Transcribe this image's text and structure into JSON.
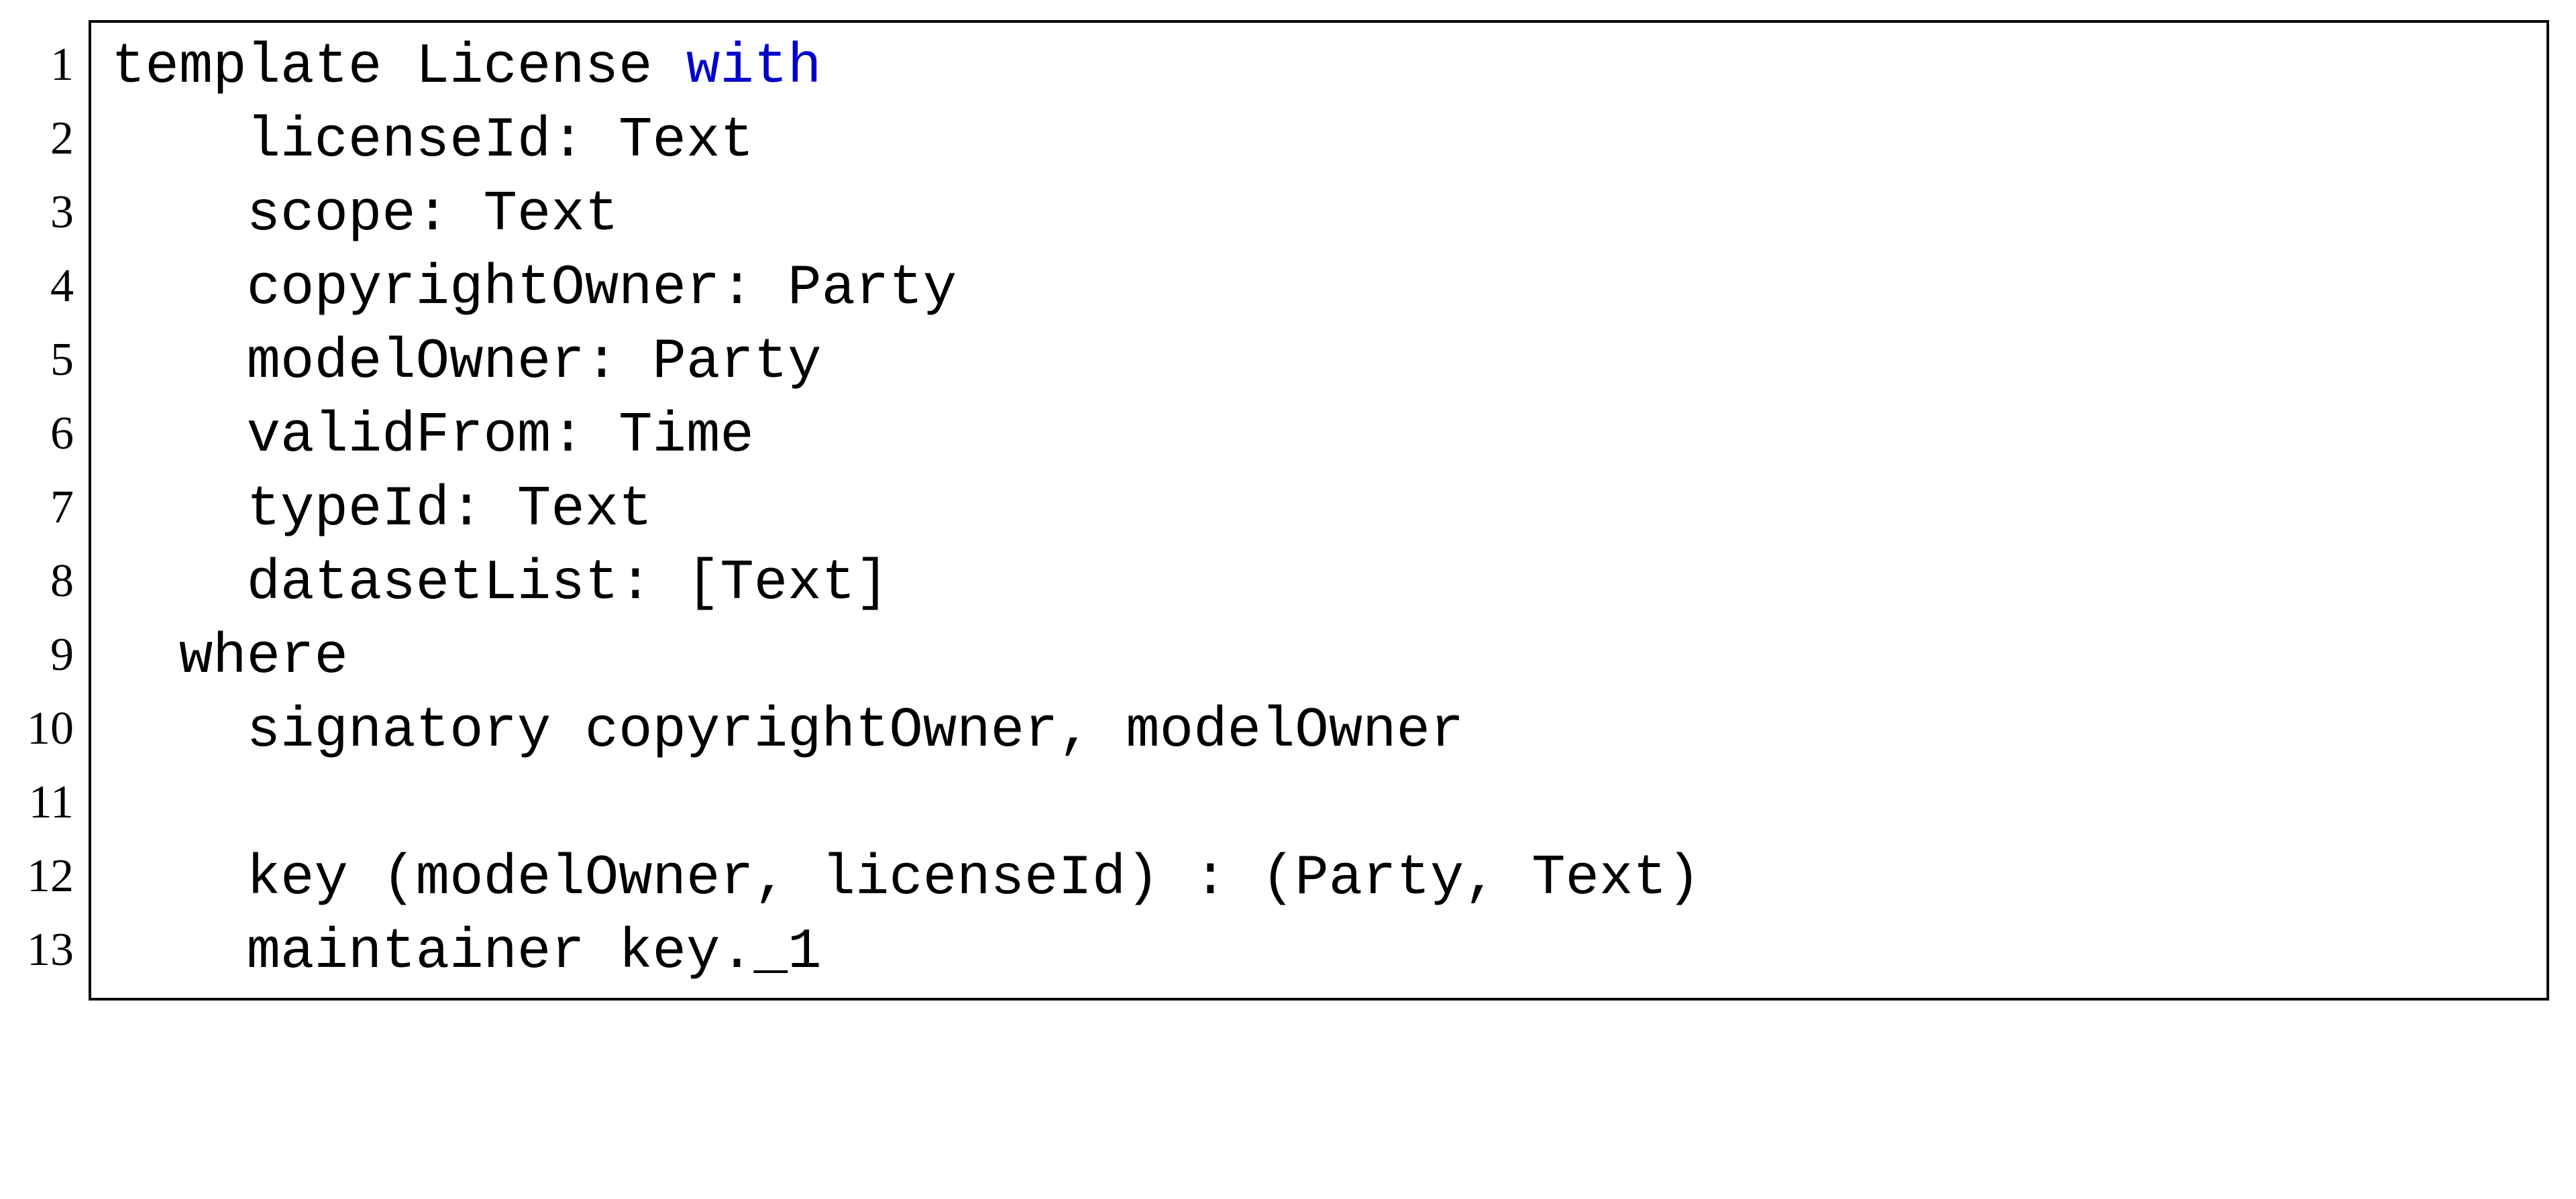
{
  "code": {
    "lines": [
      {
        "num": "1",
        "indent": "",
        "pre": "template License ",
        "kw": "with",
        "post": ""
      },
      {
        "num": "2",
        "indent": "    ",
        "pre": "licenseId: Text",
        "kw": "",
        "post": ""
      },
      {
        "num": "3",
        "indent": "    ",
        "pre": "scope: Text",
        "kw": "",
        "post": ""
      },
      {
        "num": "4",
        "indent": "    ",
        "pre": "copyrightOwner: Party",
        "kw": "",
        "post": ""
      },
      {
        "num": "5",
        "indent": "    ",
        "pre": "modelOwner: Party",
        "kw": "",
        "post": ""
      },
      {
        "num": "6",
        "indent": "    ",
        "pre": "validFrom: Time",
        "kw": "",
        "post": ""
      },
      {
        "num": "7",
        "indent": "    ",
        "pre": "typeId: Text",
        "kw": "",
        "post": ""
      },
      {
        "num": "8",
        "indent": "    ",
        "pre": "datasetList: [Text]",
        "kw": "",
        "post": ""
      },
      {
        "num": "9",
        "indent": "  ",
        "pre": "where",
        "kw": "",
        "post": ""
      },
      {
        "num": "10",
        "indent": "    ",
        "pre": "signatory copyrightOwner, modelOwner",
        "kw": "",
        "post": ""
      },
      {
        "num": "11",
        "indent": "",
        "pre": "",
        "kw": "",
        "post": ""
      },
      {
        "num": "12",
        "indent": "    ",
        "pre": "key (modelOwner, licenseId) : (Party, Text)",
        "kw": "",
        "post": ""
      },
      {
        "num": "13",
        "indent": "    ",
        "pre": "maintainer key._1",
        "kw": "",
        "post": ""
      }
    ]
  }
}
